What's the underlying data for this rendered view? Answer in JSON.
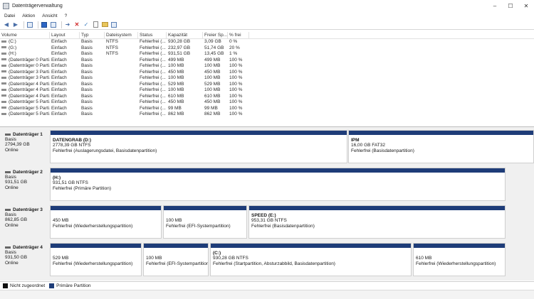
{
  "window": {
    "title": "Datenträgerverwaltung",
    "buttons": [
      "–",
      "☐",
      "✕"
    ]
  },
  "menu": [
    "Datei",
    "Aktion",
    "Ansicht",
    "?"
  ],
  "toolbar": [
    "back-arrow-icon",
    "forward-arrow-icon",
    "console-tree-icon",
    "help-icon",
    "properties-icon",
    "connect-icon",
    "delete-icon",
    "check-icon",
    "document-icon",
    "folder-icon",
    "export-icon"
  ],
  "volume_list": {
    "headers": [
      "Volume",
      "Layout",
      "Typ",
      "Dateisystem",
      "Status",
      "Kapazität",
      "Freier Sp...",
      "% frei"
    ],
    "rows": [
      [
        "(C:)",
        "Einfach",
        "Basis",
        "NTFS",
        "Fehlerfrei (...",
        "930,28 GB",
        "3,09 GB",
        "0 %"
      ],
      [
        "(G:)",
        "Einfach",
        "Basis",
        "NTFS",
        "Fehlerfrei (...",
        "232,97 GB",
        "51,74 GB",
        "20 %"
      ],
      [
        "(H:)",
        "Einfach",
        "Basis",
        "NTFS",
        "Fehlerfrei (...",
        "931,51 GB",
        "13,45 GB",
        "1 %"
      ],
      [
        "(Datenträger 0 Parti...",
        "Einfach",
        "Basis",
        "",
        "Fehlerfrei (...",
        "499 MB",
        "499 MB",
        "100 %"
      ],
      [
        "(Datenträger 0 Parti...",
        "Einfach",
        "Basis",
        "",
        "Fehlerfrei (...",
        "100 MB",
        "100 MB",
        "100 %"
      ],
      [
        "(Datenträger 3 Parti...",
        "Einfach",
        "Basis",
        "",
        "Fehlerfrei (...",
        "450 MB",
        "450 MB",
        "100 %"
      ],
      [
        "(Datenträger 3 Parti...",
        "Einfach",
        "Basis",
        "",
        "Fehlerfrei (...",
        "100 MB",
        "100 MB",
        "100 %"
      ],
      [
        "(Datenträger 4 Parti...",
        "Einfach",
        "Basis",
        "",
        "Fehlerfrei (...",
        "529 MB",
        "529 MB",
        "100 %"
      ],
      [
        "(Datenträger 4 Parti...",
        "Einfach",
        "Basis",
        "",
        "Fehlerfrei (...",
        "100 MB",
        "100 MB",
        "100 %"
      ],
      [
        "(Datenträger 4 Parti...",
        "Einfach",
        "Basis",
        "",
        "Fehlerfrei (...",
        "610 MB",
        "610 MB",
        "100 %"
      ],
      [
        "(Datenträger 5 Parti...",
        "Einfach",
        "Basis",
        "",
        "Fehlerfrei (...",
        "450 MB",
        "450 MB",
        "100 %"
      ],
      [
        "(Datenträger 5 Parti...",
        "Einfach",
        "Basis",
        "",
        "Fehlerfrei (...",
        "99 MB",
        "99 MB",
        "100 %"
      ],
      [
        "(Datenträger 5 Parti...",
        "Einfach",
        "Basis",
        "",
        "Fehlerfrei (...",
        "862 MB",
        "862 MB",
        "100 %"
      ]
    ]
  },
  "disks": [
    {
      "name": "Datenträger 1",
      "type": "Basis",
      "size": "2794,39 GB",
      "state": "Online",
      "partitions": [
        {
          "name": "DATENGRAB (D:)",
          "size": "2778,39 GB NTFS",
          "status": "Fehlerfrei (Auslagerungsdatei, Basisdatenpartition)"
        },
        {
          "name": "IPM",
          "size": "16,00 GB FAT32",
          "status": "Fehlerfrei (Basisdatenpartition)"
        }
      ]
    },
    {
      "name": "Datenträger 2",
      "type": "Basis",
      "size": "931,51 GB",
      "state": "Online",
      "partitions": [
        {
          "name": "(H:)",
          "size": "931,51 GB NTFS",
          "status": "Fehlerfrei (Primäre Partition)"
        }
      ]
    },
    {
      "name": "Datenträger 3",
      "type": "Basis",
      "size": "862,85 GB",
      "state": "Online",
      "partitions": [
        {
          "name": "",
          "size": "450 MB",
          "status": "Fehlerfrei (Wiederherstellungspartition)"
        },
        {
          "name": "",
          "size": "100 MB",
          "status": "Fehlerfrei (EFI-Systempartition)"
        },
        {
          "name": "SPEED (E:)",
          "size": "953,31 GB NTFS",
          "status": "Fehlerfrei (Basisdatenpartition)"
        }
      ]
    },
    {
      "name": "Datenträger 4",
      "type": "Basis",
      "size": "931,50 GB",
      "state": "Online",
      "partitions": [
        {
          "name": "",
          "size": "529 MB",
          "status": "Fehlerfrei (Wiederherstellungspartition)"
        },
        {
          "name": "",
          "size": "100 MB",
          "status": "Fehlerfrei (EFI-Systempartition)"
        },
        {
          "name": "(C:)",
          "size": "930,28 GB NTFS",
          "status": "Fehlerfrei (Startpartition, Absturzabbild, Basisdatenpartition)"
        },
        {
          "name": "",
          "size": "610 MB",
          "status": "Fehlerfrei (Wiederherstellungspartition)"
        }
      ]
    }
  ],
  "legend": [
    {
      "label": "Nicht zugeordnet",
      "color": "#111111"
    },
    {
      "label": "Primäre Partition",
      "color": "#1e3c78"
    }
  ]
}
